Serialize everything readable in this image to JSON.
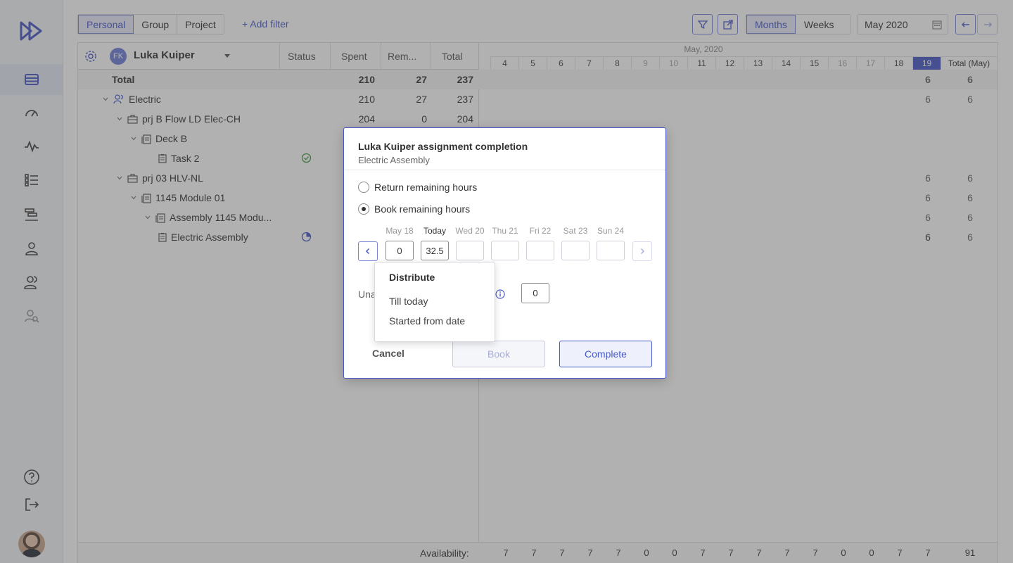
{
  "toolbar": {
    "tabs": [
      {
        "label": "Personal",
        "active": true
      },
      {
        "label": "Group",
        "active": false
      },
      {
        "label": "Project",
        "active": false
      }
    ],
    "add_filter": "+ Add filter",
    "view_modes": [
      {
        "label": "Months",
        "active": true
      },
      {
        "label": "Weeks",
        "active": false
      }
    ],
    "date_value": "May 2020"
  },
  "grid": {
    "user_initials": "FK",
    "user_name": "Luka Kuiper",
    "col_status": "Status",
    "col_spent": "Spent",
    "col_remaining": "Rem...",
    "col_total": "Total",
    "month_label": "May, 2020",
    "days": [
      "4",
      "5",
      "6",
      "7",
      "8",
      "9",
      "10",
      "11",
      "12",
      "13",
      "14",
      "15",
      "16",
      "17",
      "18",
      "19"
    ],
    "weekend_days": [
      "9",
      "10",
      "16",
      "17"
    ],
    "today_day": "19",
    "total_col_label": "Total (May)",
    "rows": [
      {
        "name": "Total",
        "spent": "210",
        "rem": "27",
        "total": "237",
        "day19": "6",
        "month_total": "6",
        "type": "total"
      },
      {
        "name": "Electric",
        "spent": "210",
        "rem": "27",
        "total": "237",
        "day19": "6",
        "month_total": "6",
        "type": "group"
      },
      {
        "name": "prj B Flow LD Elec-CH",
        "spent": "204",
        "rem": "0",
        "total": "204",
        "day19": "",
        "month_total": "",
        "type": "project"
      },
      {
        "name": "Deck B",
        "spent": "",
        "rem": "",
        "total": "",
        "day19": "",
        "month_total": "",
        "type": "phase"
      },
      {
        "name": "Task 2",
        "spent": "",
        "rem": "",
        "total": "",
        "day19": "",
        "month_total": "",
        "type": "task",
        "status": "done"
      },
      {
        "name": "prj 03 HLV-NL",
        "spent": "",
        "rem": "",
        "total": "",
        "day19": "6",
        "month_total": "6",
        "type": "project"
      },
      {
        "name": "1145 Module 01",
        "spent": "",
        "rem": "",
        "total": "",
        "day19": "6",
        "month_total": "6",
        "type": "phase"
      },
      {
        "name": "Assembly 1145 Modu...",
        "spent": "",
        "rem": "",
        "total": "",
        "day19": "6",
        "month_total": "6",
        "type": "subphase"
      },
      {
        "name": "Electric Assembly",
        "spent": "",
        "rem": "",
        "total": "",
        "day19": "6",
        "month_total": "6",
        "type": "task",
        "status": "progress"
      }
    ],
    "availability_label": "Availability:",
    "availability": [
      "7",
      "7",
      "7",
      "7",
      "7",
      "0",
      "0",
      "7",
      "7",
      "7",
      "7",
      "7",
      "0",
      "0",
      "7",
      "7"
    ],
    "availability_total": "91"
  },
  "modal": {
    "title": "Luka Kuiper assignment completion",
    "subtitle": "Electric Assembly",
    "option_return": "Return remaining hours",
    "option_book": "Book remaining hours",
    "selected_option": "book",
    "day_labels": [
      "May 18",
      "Today",
      "Wed 20",
      "Thu 21",
      "Fri 22",
      "Sat 23",
      "Sun 24"
    ],
    "day_values": [
      "0",
      "32.5",
      "",
      "",
      "",
      "",
      ""
    ],
    "unassigned_label": "Una",
    "unassigned_value": "0",
    "cancel": "Cancel",
    "book": "Book",
    "complete": "Complete"
  },
  "dropdown": {
    "header": "Distribute",
    "items": [
      "Till today",
      "Started from date"
    ]
  },
  "colors": {
    "accent": "#4759c8",
    "overlay": "#464646"
  }
}
